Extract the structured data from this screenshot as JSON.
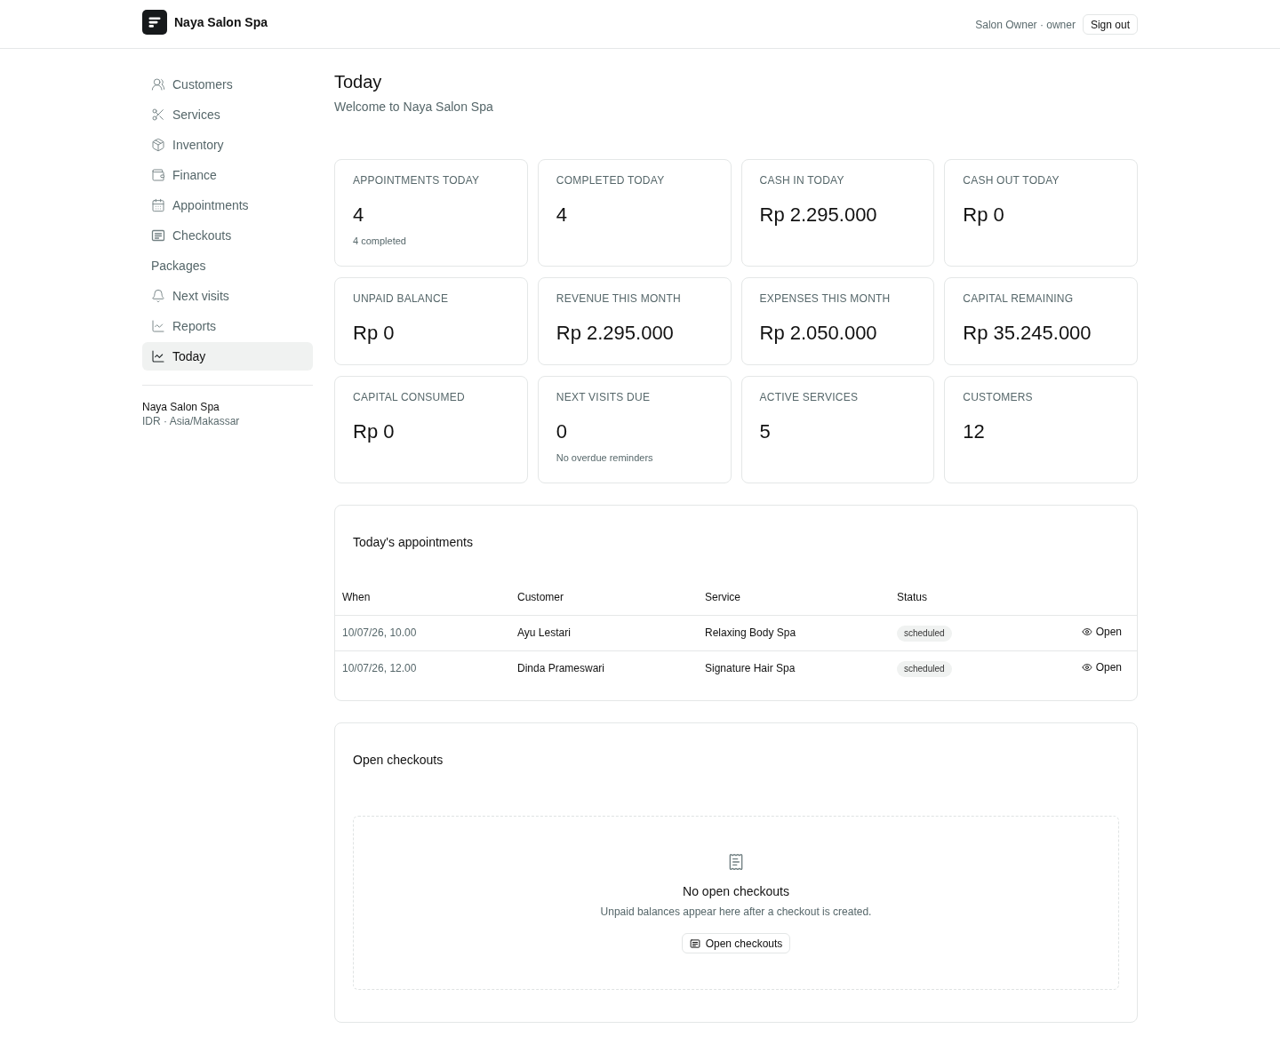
{
  "header": {
    "brand": "Naya Salon Spa",
    "user": "Salon Owner · owner",
    "sign_out": "Sign out"
  },
  "sidebar": {
    "items": [
      {
        "label": "Customers",
        "selected": false
      },
      {
        "label": "Services",
        "selected": false
      },
      {
        "label": "Inventory",
        "selected": false
      },
      {
        "label": "Finance",
        "selected": false
      },
      {
        "label": "Appointments",
        "selected": false
      },
      {
        "label": "Checkouts",
        "selected": false
      },
      {
        "label": "Packages",
        "selected": false
      },
      {
        "label": "Next visits",
        "selected": false
      },
      {
        "label": "Reports",
        "selected": false
      },
      {
        "label": "Today",
        "selected": true
      }
    ],
    "footer": {
      "name": "Naya Salon Spa",
      "detail": "IDR · Asia/Makassar"
    }
  },
  "page": {
    "title": "Today",
    "subtitle": "Welcome to Naya Salon Spa"
  },
  "stats": [
    {
      "label": "APPOINTMENTS TODAY",
      "value": "4",
      "note": "4 completed"
    },
    {
      "label": "COMPLETED TODAY",
      "value": "4"
    },
    {
      "label": "CASH IN TODAY",
      "value": "Rp 2.295.000"
    },
    {
      "label": "CASH OUT TODAY",
      "value": "Rp 0"
    },
    {
      "label": "UNPAID BALANCE",
      "value": "Rp 0"
    },
    {
      "label": "REVENUE THIS MONTH",
      "value": "Rp 2.295.000"
    },
    {
      "label": "EXPENSES THIS MONTH",
      "value": "Rp 2.050.000"
    },
    {
      "label": "CAPITAL REMAINING",
      "value": "Rp 35.245.000"
    },
    {
      "label": "CAPITAL CONSUMED",
      "value": "Rp 0"
    },
    {
      "label": "NEXT VISITS DUE",
      "value": "0",
      "note": "No overdue reminders"
    },
    {
      "label": "ACTIVE SERVICES",
      "value": "5"
    },
    {
      "label": "CUSTOMERS",
      "value": "12"
    }
  ],
  "appointments": {
    "title": "Today's appointments",
    "columns": [
      "When",
      "Customer",
      "Service",
      "Status"
    ],
    "rows": [
      {
        "when": "10/07/26, 10.00",
        "customer": "Ayu Lestari",
        "service": "Relaxing Body Spa",
        "status": "scheduled",
        "action": "Open"
      },
      {
        "when": "10/07/26, 12.00",
        "customer": "Dinda Prameswari",
        "service": "Signature Hair Spa",
        "status": "scheduled",
        "action": "Open"
      }
    ]
  },
  "checkouts": {
    "title": "Open checkouts",
    "empty": {
      "title": "No open checkouts",
      "message": "Unpaid balances appear here after a checkout is created.",
      "button": "Open checkouts"
    }
  }
}
